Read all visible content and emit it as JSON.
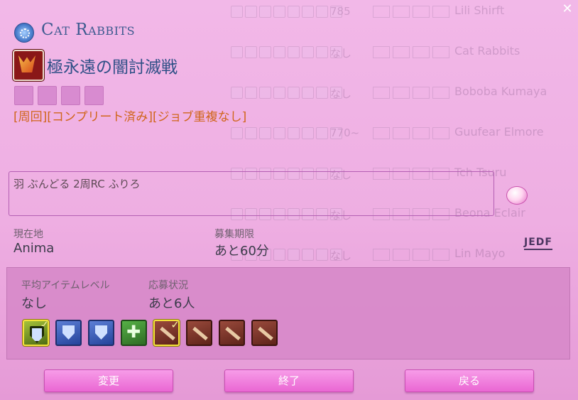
{
  "background_list": [
    {
      "stat": "785",
      "name": "Lili Shirft"
    },
    {
      "stat": "なし",
      "name": "Cat Rabbits"
    },
    {
      "stat": "なし",
      "name": "Boboba Kumaya"
    },
    {
      "stat": "770~",
      "name": "Guufear Elmore"
    },
    {
      "stat": "なし",
      "name": "Tch Tsuru"
    },
    {
      "stat": "なし",
      "name": "Beona Eclair"
    },
    {
      "stat": "なし",
      "name": "Lin Mayo"
    }
  ],
  "window": {
    "close_label": "✕"
  },
  "header": {
    "fc_name": "Cat Rabbits",
    "duty_name": "極永遠の闇討滅戦",
    "tags": "[周回][コンプリート済み][ジョブ重複なし]"
  },
  "comment": {
    "text": "羽 ぶんどる 2周RC ふりろ"
  },
  "info": {
    "location_label": "現在地",
    "location_value": "Anima",
    "deadline_label": "募集期限",
    "deadline_value": "あと60分",
    "jedf_label": "JEDF",
    "avg_ilvl_label": "平均アイテムレベル",
    "avg_ilvl_value": "なし",
    "status_label": "応募状況",
    "status_value": "あと6人"
  },
  "party_slots": [
    {
      "role": "tank",
      "filled": true,
      "icon": "gunbreaker-icon"
    },
    {
      "role": "tank",
      "filled": false,
      "icon": "tank-shield-icon"
    },
    {
      "role": "tank",
      "filled": false,
      "icon": "tank-shield-icon"
    },
    {
      "role": "healer",
      "filled": false,
      "icon": "healer-cross-icon"
    },
    {
      "role": "dps",
      "filled": true,
      "icon": "dps-sword-icon"
    },
    {
      "role": "dps",
      "filled": false,
      "icon": "dps-sword-icon"
    },
    {
      "role": "dps",
      "filled": false,
      "icon": "dps-sword-icon"
    },
    {
      "role": "dps",
      "filled": false,
      "icon": "dps-sword-icon"
    }
  ],
  "buttons": {
    "change": "変更",
    "end": "終了",
    "back": "戻る"
  },
  "colors": {
    "accent_pink": "#ea67d3",
    "title_blue": "#2e4f86",
    "tags_orange": "#d0651a"
  }
}
